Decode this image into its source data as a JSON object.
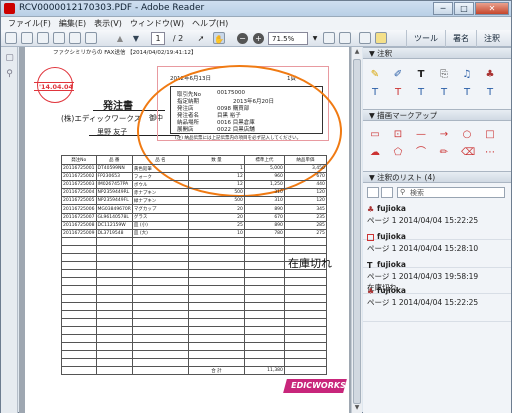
{
  "app": {
    "title": "RCV0000012170303.PDF - Adobe Reader",
    "min": "─",
    "max": "□",
    "close": "✕"
  },
  "menu": [
    "ファイル(F)",
    "編集(E)",
    "表示(V)",
    "ウィンドウ(W)",
    "ヘルプ(H)"
  ],
  "toolbar": {
    "page_current": "1",
    "page_total": "/ 2",
    "zoom": "71.5%",
    "tools": "ツール",
    "sign": "署名",
    "comment": "注釈"
  },
  "document": {
    "fax_header": "ファクシミリからの FAX送信 【2014/04/02/19:41:12】",
    "stamp_date": "'14.04.04",
    "doc_title": "発注書",
    "customer": "(株)エディックワークス",
    "honorific": "御中",
    "person": "里野 友子",
    "date": "2012年6月13日",
    "page_no": "1頁",
    "fields": [
      {
        "label": "取引先No",
        "value": "00175000"
      },
      {
        "label": "指定納期",
        "value": "2013年6月20日"
      },
      {
        "label": "発注店",
        "value": "0098 購買部"
      },
      {
        "label": "発注者名",
        "value": "目黒 裕子"
      },
      {
        "label": "納品場所",
        "value": "0016 目黒倉庫"
      },
      {
        "label": "展開店",
        "value": "0022 目黒店舗"
      }
    ],
    "note": "(注) 納品伝票には上記伝票内の項目を必ず記入してください。",
    "table_headers": [
      "発注No",
      "品 番",
      "品 名",
      "数 量",
      "標準上代",
      "納品単価"
    ],
    "rows": [
      [
        "20116725001",
        "DT40599NN",
        "黄色鉛筆",
        "1",
        "5,000",
        "3,450"
      ],
      [
        "20116725002",
        "FP230653",
        "フォーク",
        "12",
        "960",
        "670"
      ],
      [
        "20116725003",
        "IM0267457PA",
        "ボウル",
        "12",
        "1,250",
        "440"
      ],
      [
        "20116725004",
        "NP2359449RL",
        "赤ナプキン",
        "500",
        "310",
        "120"
      ],
      [
        "20116725005",
        "NP2359449FL",
        "緑ナプキン",
        "500",
        "310",
        "120"
      ],
      [
        "20116725006",
        "MG03849670R",
        "マグカップ",
        "20",
        "890",
        "345"
      ],
      [
        "20116725007",
        "GL96140578L",
        "グラス",
        "20",
        "670",
        "235"
      ],
      [
        "20116725008",
        "DC112159W",
        "皿 (小)",
        "25",
        "890",
        "285"
      ],
      [
        "20116725009",
        "DL3719548",
        "皿 (大)",
        "10",
        "780",
        "275"
      ]
    ],
    "total_label": "合 計",
    "total_value": "11,380",
    "logo": "EDICWORKS",
    "annotation_text": "在庫切れ"
  },
  "panel": {
    "annotations_header": "注釈",
    "drawing_header": "描画マークアップ",
    "list_header": "注釈のリスト (4)",
    "search_placeholder": "検索",
    "comments": [
      {
        "icon": "stamp-icon",
        "author": "fujioka",
        "date": "ページ 1 2014/04/04 15:22:25",
        "text": ""
      },
      {
        "icon": "rectangle-icon",
        "author": "fujioka",
        "date": "ページ 1 2014/04/04 15:28:10",
        "text": ""
      },
      {
        "icon": "text-icon",
        "author": "fujioka",
        "date": "ページ 1 2014/04/03 19:58:19",
        "text": "在庫切れ"
      },
      {
        "icon": "stamp-icon",
        "author": "fujioka",
        "date": "ページ 1 2014/04/04 15:22:25",
        "text": ""
      }
    ]
  },
  "colors": {
    "accent": "#2a5ea7",
    "annotation_orange": "#f07a12",
    "stamp_red": "#e0353c",
    "logo_magenta": "#c8267b"
  }
}
